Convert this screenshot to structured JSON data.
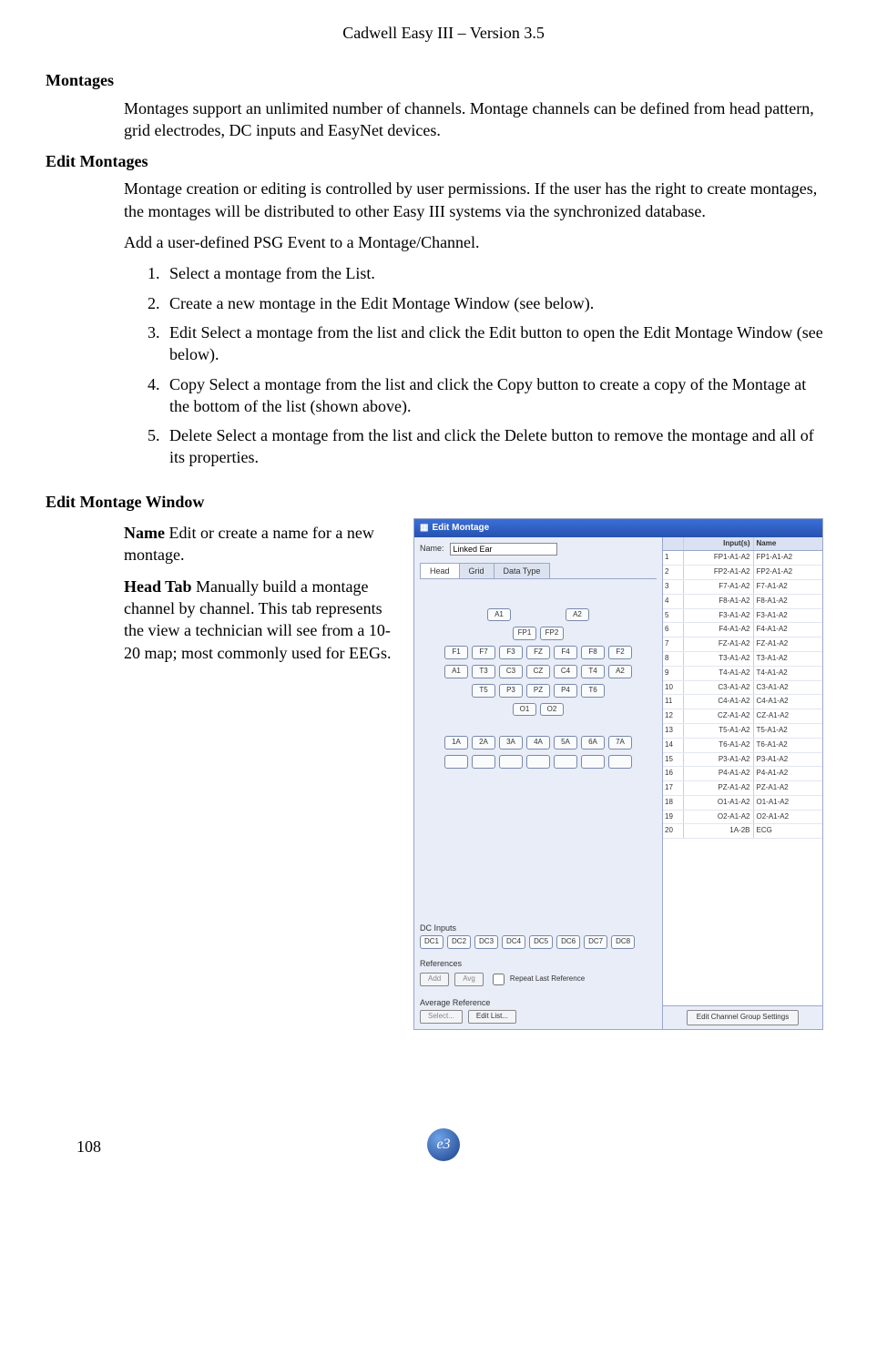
{
  "header": "Cadwell Easy III – Version 3.5",
  "h_montages": "Montages",
  "p_montages": "Montages support an unlimited number of channels. Montage channels can be defined from head pattern, grid electrodes, DC inputs and EasyNet devices.",
  "h_edit": "Edit Montages",
  "p_edit1": "Montage creation or editing is controlled by user permissions. If the user has the right to create montages, the montages will be distributed to other Easy III systems via the synchronized database.",
  "p_edit2": "Add a user-defined PSG Event to a Montage/Channel.",
  "steps": [
    "Select a montage from the List.",
    "Create a new montage in the Edit Montage Window (see below).",
    "Edit Select a montage from the list and click the Edit button to open the Edit Montage Window (see below).",
    "Copy Select a montage from the list and click the Copy button to create a copy of the Montage at the bottom of the list (shown above).",
    "Delete Select a montage from the list and click the Delete button to remove the montage and all of its properties."
  ],
  "h_window": "Edit Montage Window",
  "desc_name_b": "Name",
  "desc_name": " Edit or create a name for a new montage.",
  "desc_head_b": "Head Tab",
  "desc_head": " Manually build a montage channel by channel. This tab represents the view a technician will see from a 10-20 map; most commonly used for EEGs.",
  "ss": {
    "title": "Edit Montage",
    "name_label": "Name:",
    "name_value": "Linked Ear",
    "tabs": [
      "Head",
      "Grid",
      "Data Type"
    ],
    "rows_toppair": [
      "A1",
      "A2"
    ],
    "rows": [
      [
        "FP1",
        "FP2"
      ],
      [
        "F1",
        "F7",
        "F3",
        "FZ",
        "F4",
        "F8",
        "F2"
      ],
      [
        "A1",
        "T3",
        "C3",
        "CZ",
        "C4",
        "T4",
        "A2"
      ],
      [
        "T5",
        "P3",
        "PZ",
        "P4",
        "T6"
      ],
      [
        "O1",
        "O2"
      ],
      [
        "1A",
        "2A",
        "3A",
        "4A",
        "5A",
        "6A",
        "7A"
      ],
      [
        "",
        "",
        "",
        "",
        "",
        "",
        ""
      ]
    ],
    "dc_label": "DC Inputs",
    "dc": [
      "DC1",
      "DC2",
      "DC3",
      "DC4",
      "DC5",
      "DC6",
      "DC7",
      "DC8"
    ],
    "refs_label": "References",
    "ref_btns": [
      "Add",
      "Avg"
    ],
    "ref_chk": "Repeat Last Reference",
    "avg_label": "Average Reference",
    "avg_sel": "Select...",
    "avg_edit": "Edit List...",
    "table_hdr": [
      "",
      "Input(s)",
      "Name"
    ],
    "table": [
      [
        "1",
        "FP1-A1-A2",
        "FP1-A1-A2"
      ],
      [
        "2",
        "FP2-A1-A2",
        "FP2-A1-A2"
      ],
      [
        "3",
        "F7-A1-A2",
        "F7-A1-A2"
      ],
      [
        "4",
        "F8-A1-A2",
        "F8-A1-A2"
      ],
      [
        "5",
        "F3-A1-A2",
        "F3-A1-A2"
      ],
      [
        "6",
        "F4-A1-A2",
        "F4-A1-A2"
      ],
      [
        "7",
        "FZ-A1-A2",
        "FZ-A1-A2"
      ],
      [
        "8",
        "T3-A1-A2",
        "T3-A1-A2"
      ],
      [
        "9",
        "T4-A1-A2",
        "T4-A1-A2"
      ],
      [
        "10",
        "C3-A1-A2",
        "C3-A1-A2"
      ],
      [
        "11",
        "C4-A1-A2",
        "C4-A1-A2"
      ],
      [
        "12",
        "CZ-A1-A2",
        "CZ-A1-A2"
      ],
      [
        "13",
        "T5-A1-A2",
        "T5-A1-A2"
      ],
      [
        "14",
        "T6-A1-A2",
        "T6-A1-A2"
      ],
      [
        "15",
        "P3-A1-A2",
        "P3-A1-A2"
      ],
      [
        "16",
        "P4-A1-A2",
        "P4-A1-A2"
      ],
      [
        "17",
        "PZ-A1-A2",
        "PZ-A1-A2"
      ],
      [
        "18",
        "O1-A1-A2",
        "O1-A1-A2"
      ],
      [
        "19",
        "O2-A1-A2",
        "O2-A1-A2"
      ],
      [
        "20",
        "1A-2B",
        "ECG"
      ]
    ],
    "footer_btn": "Edit Channel Group Settings"
  },
  "page_num": "108",
  "logo_text": "e3"
}
